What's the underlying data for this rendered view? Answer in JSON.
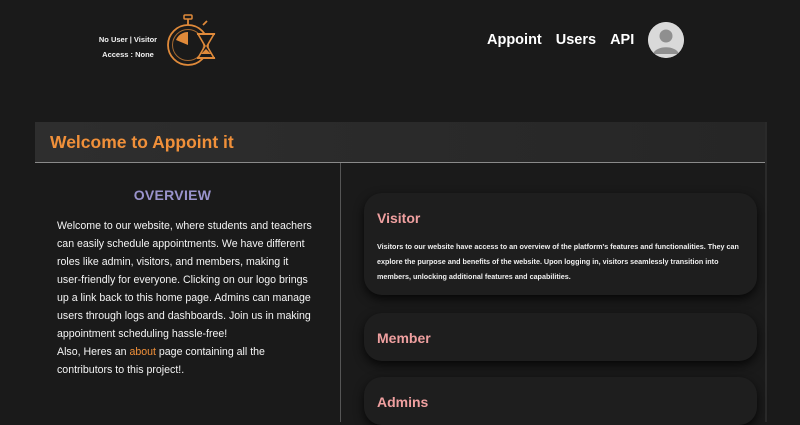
{
  "user_status": {
    "line1": "No User | Visitor",
    "line2": "Access : None"
  },
  "nav": {
    "appoint_label": "Appoint",
    "users_label": "Users",
    "api_label": "API"
  },
  "welcome": {
    "title": "Welcome to Appoint it"
  },
  "overview": {
    "heading": "OVERVIEW",
    "paragraph": "Welcome to our website, where students and teachers can easily schedule appointments. We have different roles like admin, visitors, and members, making it user-friendly for everyone. Clicking on our logo brings up a link back to this home page. Admins can manage users through logs and dashboards. Join us in making appointment scheduling hassle-free!",
    "about_prefix": "Also, Heres an ",
    "about_link": "about",
    "about_suffix": " page containing all the contributors to this project!."
  },
  "roles": [
    {
      "title": "Visitor",
      "description": "Visitors to our website have access to an overview of the platform's features and functionalities. They can explore the purpose and benefits of the website. Upon logging in, visitors seamlessly transition into members, unlocking additional features and capabilities."
    },
    {
      "title": "Member"
    },
    {
      "title": "Admins"
    }
  ],
  "colors": {
    "accent_orange": "#f0903a",
    "overview_purple": "#9a93cc",
    "role_title_pink": "#f0a0a0",
    "background": "#1a1a1a"
  },
  "icons": {
    "logo": "stopwatch-hourglass-logo",
    "avatar": "user-avatar-icon"
  }
}
